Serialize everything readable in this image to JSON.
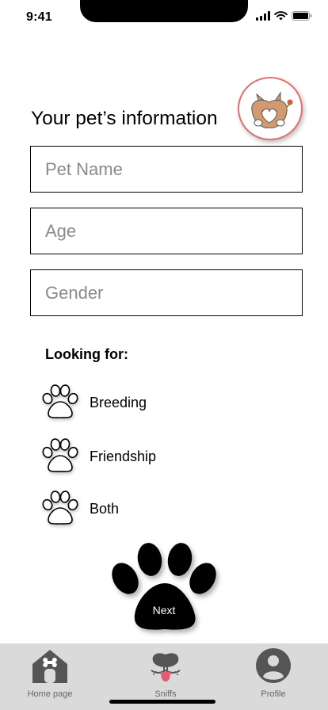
{
  "status_bar": {
    "time": "9:41"
  },
  "header": {
    "title": "Your pet’s information"
  },
  "form": {
    "pet_name_placeholder": "Pet Name",
    "age_placeholder": "Age",
    "gender_placeholder": "Gender"
  },
  "looking_for": {
    "label": "Looking for:",
    "options": [
      {
        "label": "Breeding"
      },
      {
        "label": "Friendship"
      },
      {
        "label": "Both"
      }
    ]
  },
  "next_button": {
    "label": "Next"
  },
  "tab_bar": {
    "tabs": [
      {
        "label": "Home page",
        "icon": "house-icon"
      },
      {
        "label": "Sniffs",
        "icon": "dog-nose-icon"
      },
      {
        "label": "Profile",
        "icon": "user-circle-icon"
      }
    ]
  },
  "colors": {
    "accent": "#e26f6f",
    "tab_bar": "#dadada",
    "tab_icon": "#555555"
  }
}
